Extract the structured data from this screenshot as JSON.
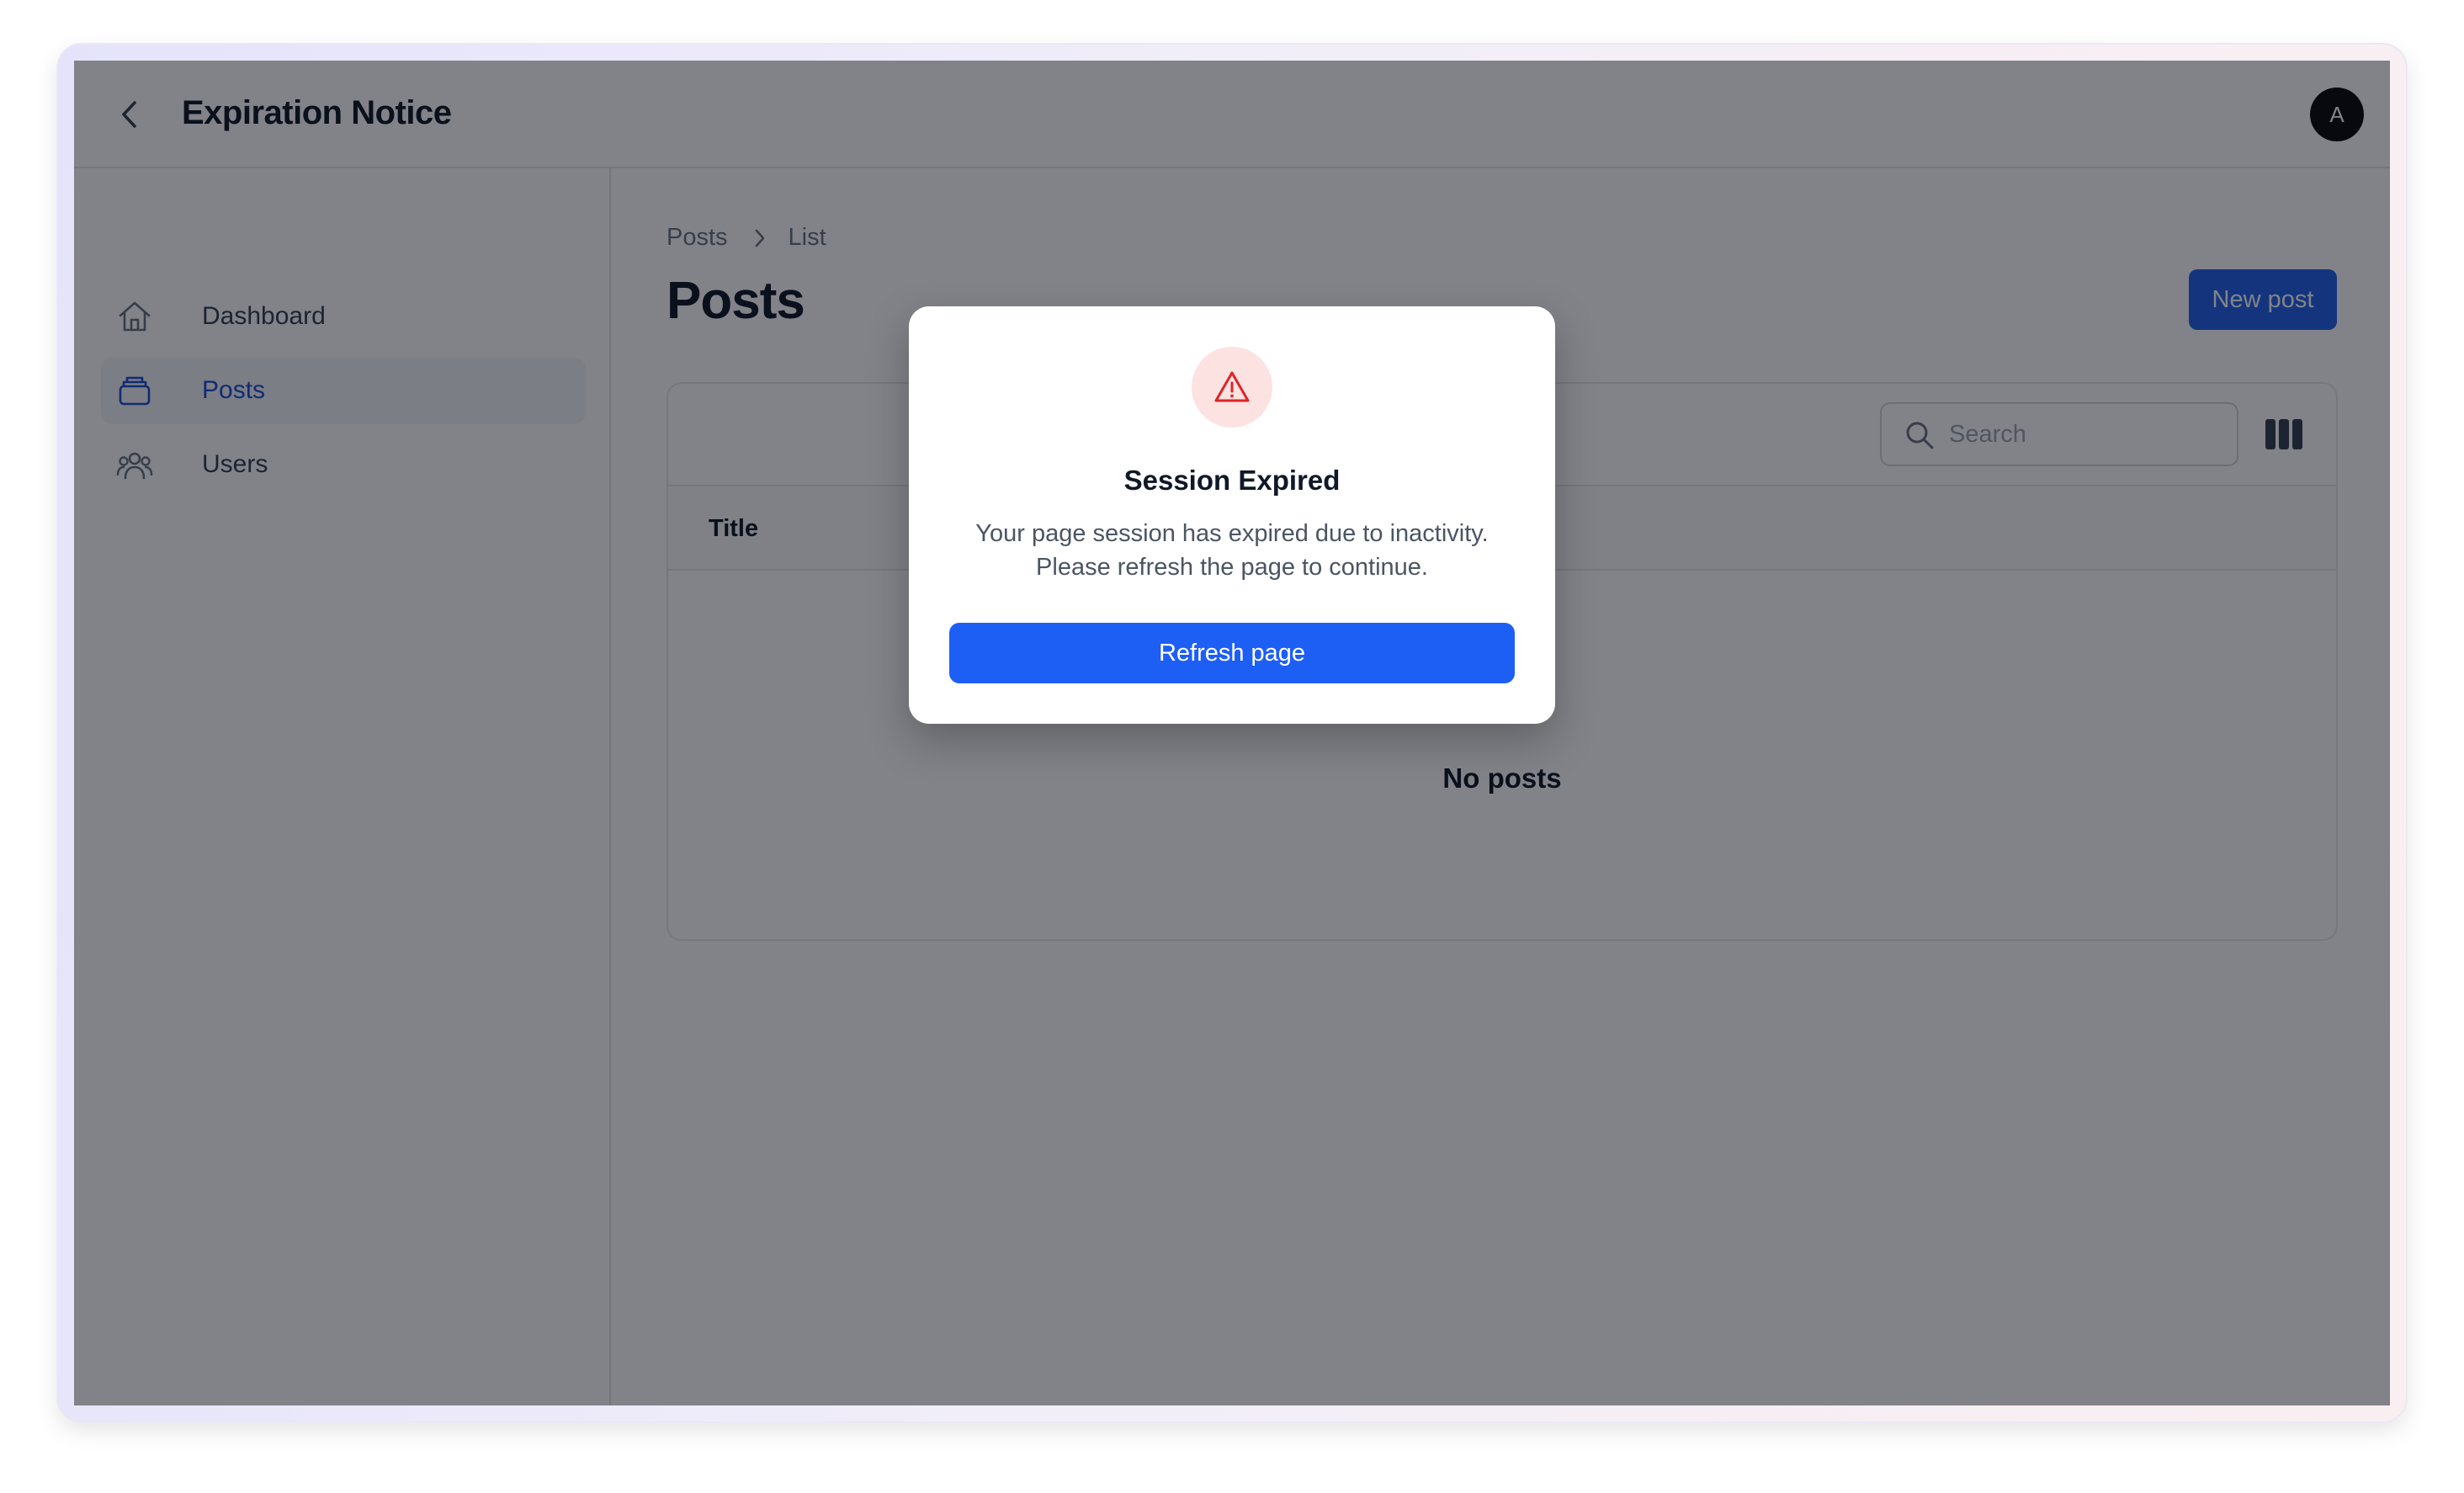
{
  "header": {
    "title": "Expiration Notice",
    "avatar_initial": "A"
  },
  "sidebar": {
    "items": [
      {
        "label": "Dashboard",
        "icon": "home-icon",
        "active": false
      },
      {
        "label": "Posts",
        "icon": "archive-icon",
        "active": true
      },
      {
        "label": "Users",
        "icon": "users-icon",
        "active": false
      }
    ]
  },
  "main": {
    "breadcrumb": [
      "Posts",
      "List"
    ],
    "page_title": "Posts",
    "new_post_label": "New post",
    "search": {
      "placeholder": "Search",
      "value": ""
    },
    "table": {
      "columns": [
        "Title"
      ],
      "empty_text": "No posts"
    }
  },
  "modal": {
    "title": "Session Expired",
    "body_line1": "Your page session has expired due to inactivity.",
    "body_line2": "Please refresh the page to continue.",
    "button_label": "Refresh page",
    "icon": "warning-triangle-icon"
  },
  "colors": {
    "accent": "#2563eb",
    "modal_button": "#1d5ef5",
    "warning": "#dc2626",
    "warning_bg": "#fde2e2",
    "active_nav_text": "#1d4ed8"
  }
}
